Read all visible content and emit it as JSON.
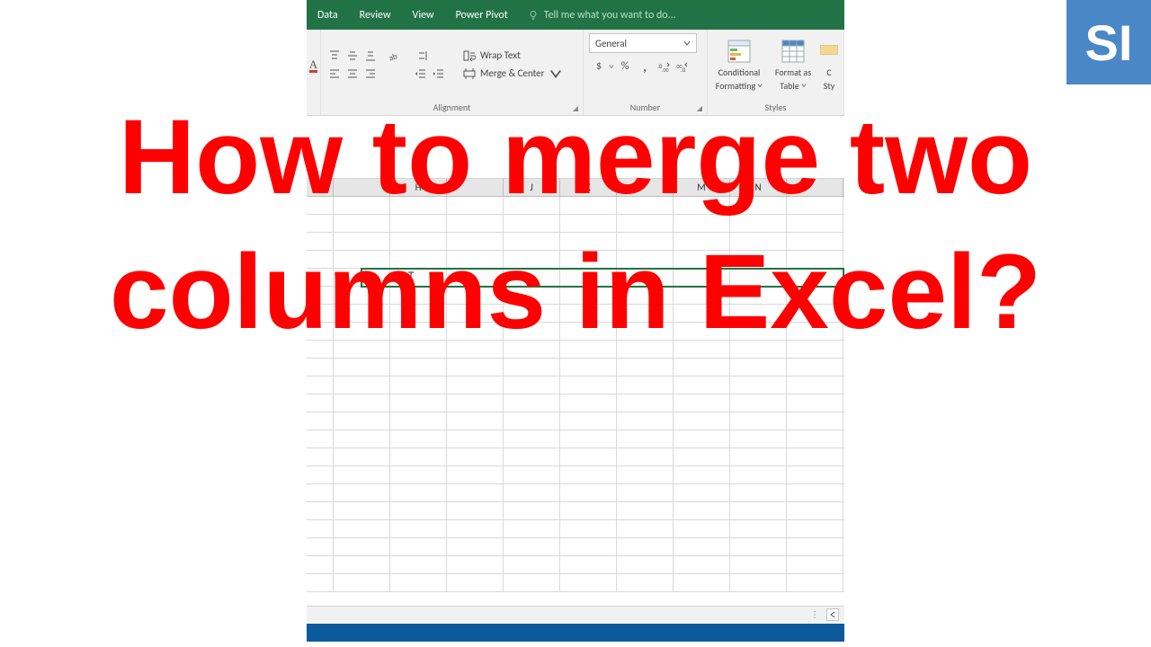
{
  "ribbon": {
    "tabs": [
      "Data",
      "Review",
      "View",
      "Power Pivot"
    ],
    "tellme_placeholder": "Tell me what you want to do..."
  },
  "alignment_group": {
    "label": "Alignment",
    "wrap_text": "Wrap Text",
    "merge_center": "Merge & Center"
  },
  "number_group": {
    "label": "Number",
    "format_selected": "General",
    "currency": "$",
    "percent": "%",
    "comma": ","
  },
  "styles_group": {
    "label": "Styles",
    "conditional_formatting_line1": "Conditional",
    "conditional_formatting_line2": "Formatting",
    "format_table_line1": "Format as",
    "format_table_line2": "Table",
    "cell_styles_partial": "C",
    "cell_styles_partial2": "Sty"
  },
  "columns": [
    "H",
    "J",
    "K",
    "M",
    "N"
  ],
  "overlay": {
    "title": "How to merge two columns in Excel?"
  },
  "logo": {
    "text": "SI"
  }
}
